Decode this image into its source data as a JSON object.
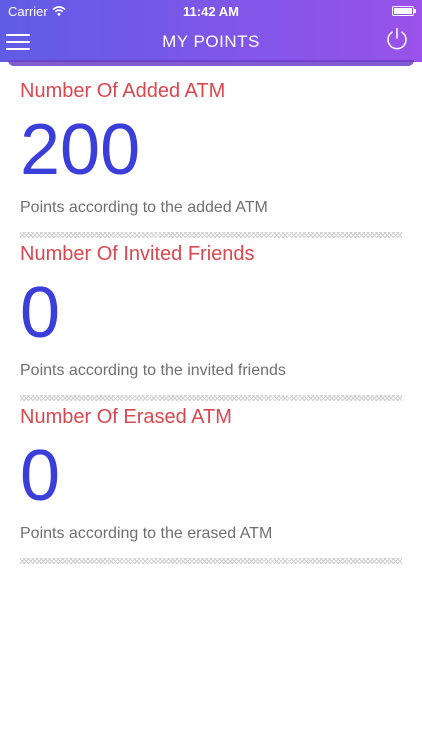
{
  "status_bar": {
    "carrier": "Carrier",
    "time": "11:42 AM",
    "battery_level": 1.0
  },
  "header": {
    "title": "MY POINTS",
    "menu_icon": "hamburger-menu-icon",
    "power_icon": "power-icon"
  },
  "sections": [
    {
      "title": "Number Of Added ATM",
      "value": "200",
      "description": "Points according to the added ATM"
    },
    {
      "title": "Number Of Invited Friends",
      "value": "0",
      "description": "Points according to the invited friends"
    },
    {
      "title": "Number Of Erased ATM",
      "value": "0",
      "description": "Points according to the erased ATM"
    }
  ],
  "colors": {
    "header_gradient_start": "#5f5ce6",
    "header_gradient_end": "#9a52ea",
    "section_title": "#d9474f",
    "value": "#3c3ed9",
    "description": "#6f6f6f"
  }
}
